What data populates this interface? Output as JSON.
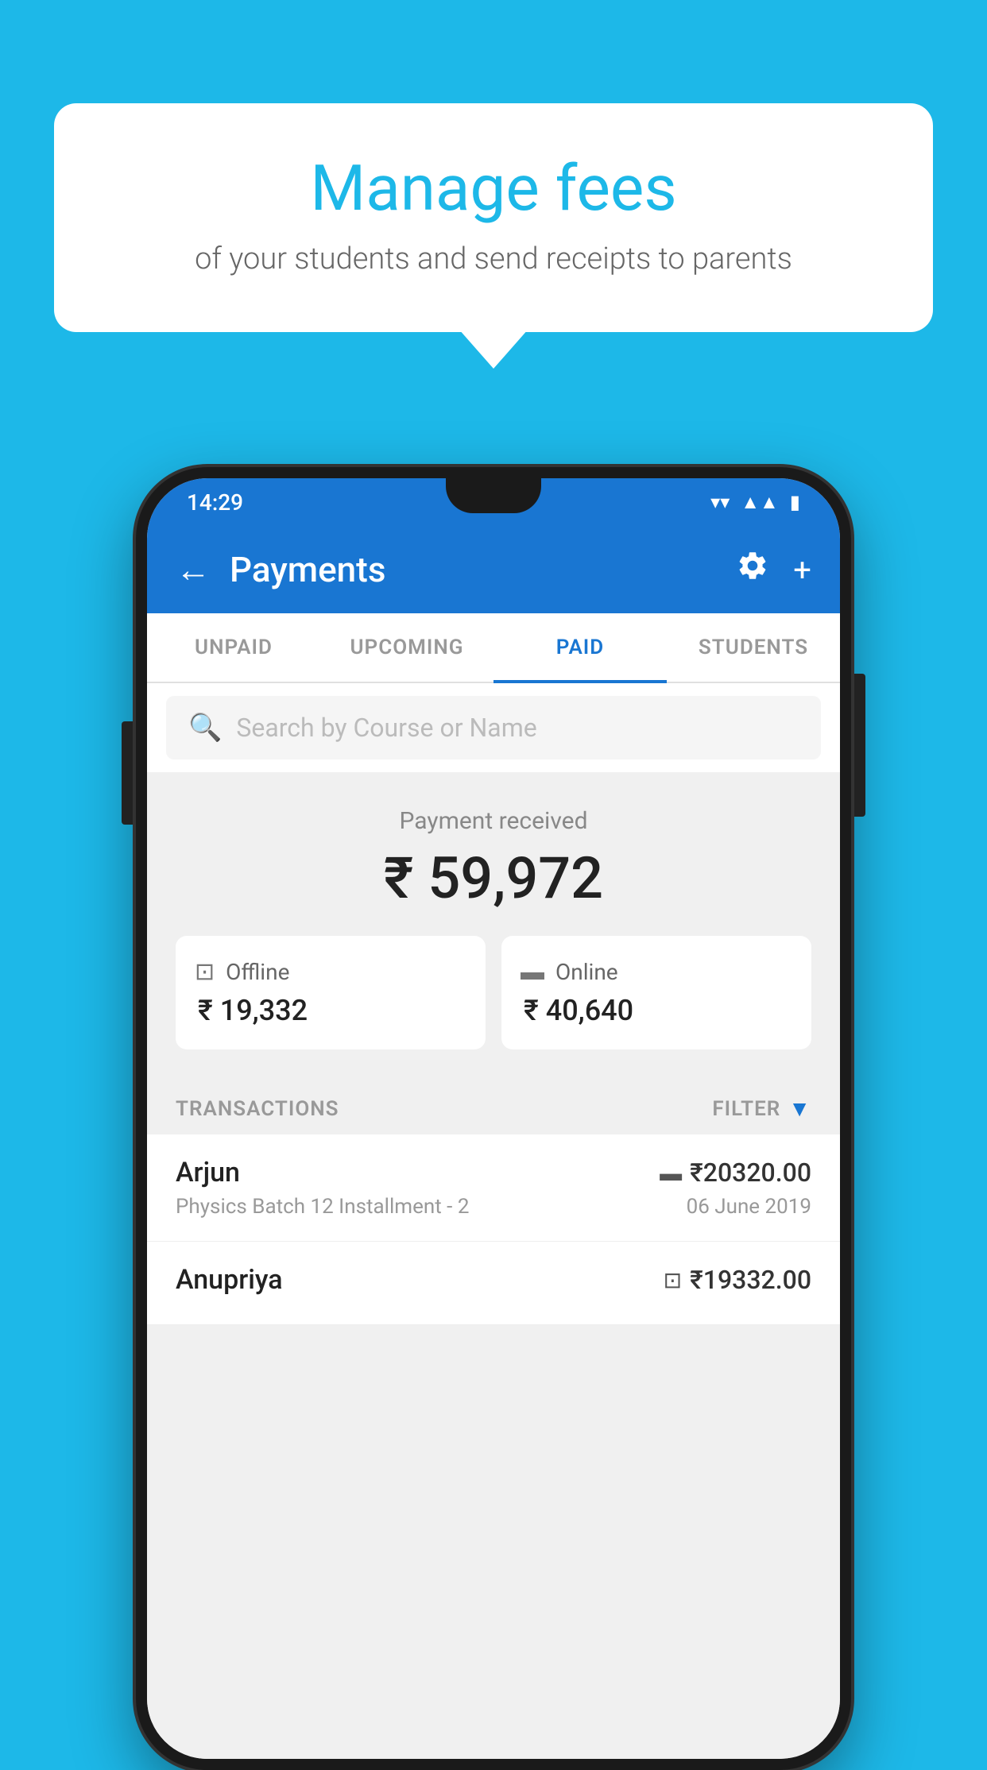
{
  "background_color": "#1db8e8",
  "bubble": {
    "title": "Manage fees",
    "subtitle": "of your students and send receipts to parents"
  },
  "status_bar": {
    "time": "14:29",
    "wifi": "▾",
    "signal": "◂",
    "battery": "▮"
  },
  "app_bar": {
    "title": "Payments",
    "back_label": "←",
    "plus_label": "+"
  },
  "tabs": [
    {
      "id": "unpaid",
      "label": "UNPAID",
      "active": false
    },
    {
      "id": "upcoming",
      "label": "UPCOMING",
      "active": false
    },
    {
      "id": "paid",
      "label": "PAID",
      "active": true
    },
    {
      "id": "students",
      "label": "STUDENTS",
      "active": false
    }
  ],
  "search": {
    "placeholder": "Search by Course or Name"
  },
  "payment_summary": {
    "label": "Payment received",
    "amount": "₹ 59,972",
    "offline": {
      "label": "Offline",
      "amount": "₹ 19,332"
    },
    "online": {
      "label": "Online",
      "amount": "₹ 40,640"
    }
  },
  "transactions": {
    "header_label": "TRANSACTIONS",
    "filter_label": "FILTER",
    "items": [
      {
        "name": "Arjun",
        "course": "Physics Batch 12 Installment - 2",
        "amount": "₹20320.00",
        "date": "06 June 2019",
        "payment_type": "online"
      },
      {
        "name": "Anupriya",
        "course": "",
        "amount": "₹19332.00",
        "date": "",
        "payment_type": "offline"
      }
    ]
  }
}
